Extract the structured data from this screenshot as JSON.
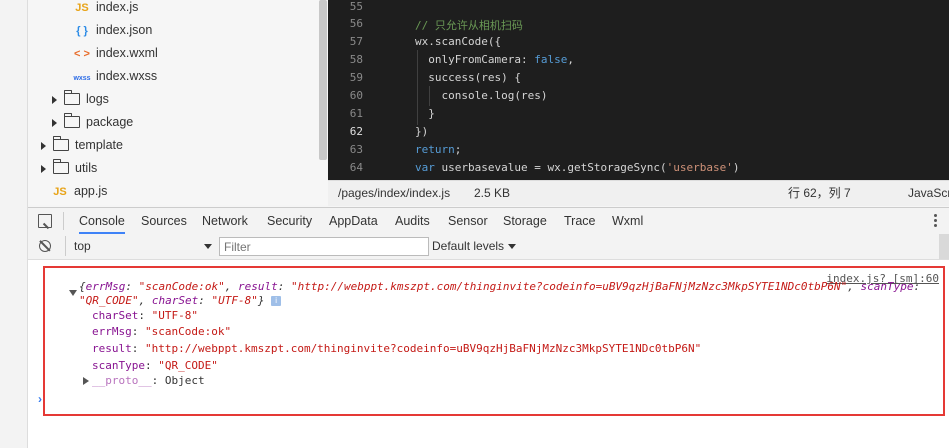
{
  "file_tree": {
    "items": [
      {
        "icon": "js-icon",
        "glyph": "JS",
        "label": "index.js"
      },
      {
        "icon": "json-icon",
        "glyph": "{ }",
        "label": "index.json"
      },
      {
        "icon": "wxml-icon",
        "glyph": "< >",
        "label": "index.wxml"
      },
      {
        "icon": "wxss-icon",
        "glyph": "wxss",
        "label": "index.wxss"
      },
      {
        "icon": "folder-icon",
        "label": "logs"
      },
      {
        "icon": "folder-icon",
        "label": "package"
      },
      {
        "icon": "folder-icon",
        "label": "template"
      },
      {
        "icon": "folder-icon",
        "label": "utils"
      },
      {
        "icon": "js-icon",
        "glyph": "JS",
        "label": "app.js"
      }
    ]
  },
  "editor": {
    "line_numbers": [
      "55",
      "56",
      "57",
      "58",
      "59",
      "60",
      "61",
      "62",
      "63",
      "64"
    ],
    "current_line": "62",
    "lines": [
      {
        "parts": []
      },
      {
        "parts": [
          {
            "t": "// 只允许从相机扫码",
            "c": "com"
          }
        ]
      },
      {
        "parts": [
          {
            "t": "wx.scanCode({",
            "c": ""
          }
        ]
      },
      {
        "parts": [
          {
            "t": "  onlyFromCamera: ",
            "c": ""
          },
          {
            "t": "false",
            "c": "bool"
          },
          {
            "t": ",",
            "c": ""
          }
        ]
      },
      {
        "parts": [
          {
            "t": "  success(res) {",
            "c": ""
          }
        ]
      },
      {
        "parts": [
          {
            "t": "    console.log(res)",
            "c": ""
          }
        ]
      },
      {
        "parts": [
          {
            "t": "  }",
            "c": ""
          }
        ]
      },
      {
        "parts": [
          {
            "t": "})",
            "c": ""
          }
        ]
      },
      {
        "parts": [
          {
            "t": "return",
            "c": "kw"
          },
          {
            "t": ";",
            "c": ""
          }
        ]
      },
      {
        "parts": [
          {
            "t": "var",
            "c": "kw"
          },
          {
            "t": " userbasevalue = wx.getStorageSync(",
            "c": ""
          },
          {
            "t": "'userbase'",
            "c": "str"
          },
          {
            "t": ")",
            "c": ""
          }
        ]
      }
    ]
  },
  "status": {
    "path": "/pages/index/index.js",
    "size": "2.5 KB",
    "position": "行 62，列 7",
    "language": "JavaScript"
  },
  "devtools": {
    "tabs": [
      "Console",
      "Sources",
      "Network",
      "Security",
      "AppData",
      "Audits",
      "Sensor",
      "Storage",
      "Trace",
      "Wxml"
    ],
    "active_tab": "Console",
    "context": "top",
    "filter_placeholder": "Filter",
    "levels": "Default levels"
  },
  "console": {
    "source_link": "index.js? [sm]:60",
    "summary_line1": [
      {
        "t": "{",
        "c": "g"
      },
      {
        "t": "errMsg",
        "c": "k"
      },
      {
        "t": ": ",
        "c": "g"
      },
      {
        "t": "\"scanCode:ok\"",
        "c": "s"
      },
      {
        "t": ", ",
        "c": "g"
      },
      {
        "t": "result",
        "c": "k"
      },
      {
        "t": ": ",
        "c": "g"
      },
      {
        "t": "\"http://webppt.kmszpt.com/thinginvite?codeinfo=uBV9qzHjBaFNjMzNzc3MkpSYTE1NDc0tbP6N\"",
        "c": "s"
      },
      {
        "t": ", ",
        "c": "g"
      },
      {
        "t": "scanType",
        "c": "k"
      },
      {
        "t": ":",
        "c": "g"
      }
    ],
    "summary_line2": [
      {
        "t": "\"QR_CODE\"",
        "c": "s"
      },
      {
        "t": ", ",
        "c": "g"
      },
      {
        "t": "charSet",
        "c": "k"
      },
      {
        "t": ": ",
        "c": "g"
      },
      {
        "t": "\"UTF-8\"",
        "c": "s"
      },
      {
        "t": "}",
        "c": "g"
      }
    ],
    "props": [
      {
        "key": "charSet",
        "value": "\"UTF-8\""
      },
      {
        "key": "errMsg",
        "value": "\"scanCode:ok\""
      },
      {
        "key": "result",
        "value": "\"http://webppt.kmszpt.com/thinginvite?codeinfo=uBV9qzHjBaFNjMzNzc3MkpSYTE1NDc0tbP6N\""
      },
      {
        "key": "scanType",
        "value": "\"QR_CODE\""
      }
    ],
    "proto_key": "__proto__",
    "proto_value": "Object",
    "prompt": "›"
  }
}
